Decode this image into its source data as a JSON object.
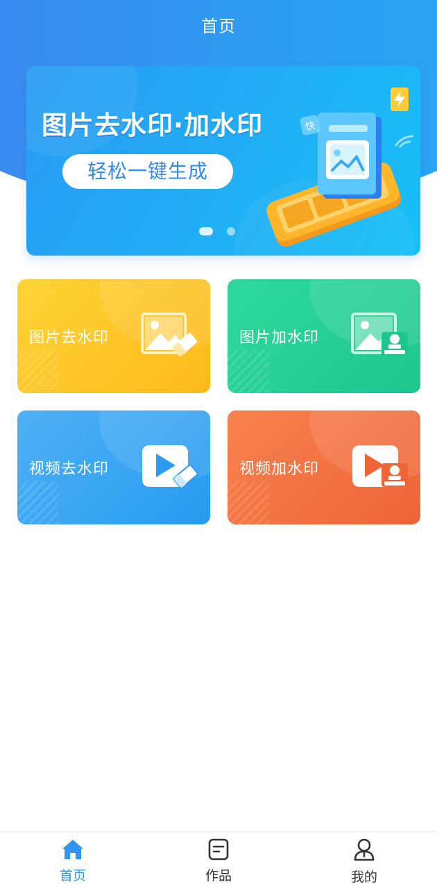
{
  "header": {
    "title": "首页"
  },
  "banner": {
    "headline": "图片去水印·加水印",
    "pill": "轻松一键生成",
    "badge_text": "快",
    "slide_count": 2,
    "active_slide": 1
  },
  "features": [
    {
      "label": "图片去水印",
      "icon": "image-eraser-icon",
      "color": "#fdb91b"
    },
    {
      "label": "图片加水印",
      "icon": "image-stamp-icon",
      "color": "#1fc68c"
    },
    {
      "label": "视频去水印",
      "icon": "video-eraser-icon",
      "color": "#279bf0"
    },
    {
      "label": "视频加水印",
      "icon": "video-stamp-icon",
      "color": "#ee6437"
    }
  ],
  "bottom_nav": {
    "items": [
      {
        "label": "首页",
        "icon": "home-icon",
        "active": true
      },
      {
        "label": "作品",
        "icon": "document-icon",
        "active": false
      },
      {
        "label": "我的",
        "icon": "user-icon",
        "active": false
      }
    ],
    "active_color": "#2f95ee"
  }
}
